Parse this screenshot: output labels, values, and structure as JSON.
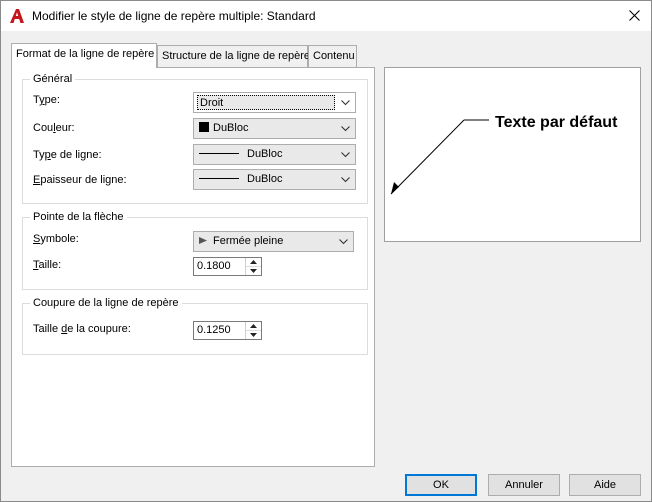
{
  "window": {
    "title": "Modifier le style de ligne de repère multiple: Standard",
    "icon": "autocad-a-icon",
    "brand_color": "#c4161c"
  },
  "tabs": [
    {
      "label": "Format de la ligne de repère",
      "active": true
    },
    {
      "label": "Structure de la ligne de repère",
      "active": false
    },
    {
      "label": "Contenu",
      "active": false
    }
  ],
  "general": {
    "legend": "Général",
    "type_label_pre": "T",
    "type_label_u": "y",
    "type_label_post": "pe:",
    "type_value": "Droit",
    "color_label_pre": "Cou",
    "color_label_u": "l",
    "color_label_post": "eur:",
    "color_value": "DuBloc",
    "linetype_label_pre": "Ty",
    "linetype_label_u": "p",
    "linetype_label_post": "e de ligne:",
    "linetype_value": "DuBloc",
    "lineweight_label_pre": "",
    "lineweight_label_u": "E",
    "lineweight_label_post": "paisseur de ligne:",
    "lineweight_value": "DuBloc"
  },
  "arrowhead": {
    "legend": "Pointe de la flèche",
    "symbol_label_pre": "",
    "symbol_label_u": "S",
    "symbol_label_post": "ymbole:",
    "symbol_value": "Fermée pleine",
    "size_label_pre": "",
    "size_label_u": "T",
    "size_label_post": "aille:",
    "size_value": "0.1800"
  },
  "landing": {
    "legend": "Coupure de la ligne de repère",
    "break_label_pre": "Taille ",
    "break_label_u": "d",
    "break_label_post": "e la coupure:",
    "break_value": "0.1250"
  },
  "preview": {
    "text": "Texte par défaut"
  },
  "buttons": {
    "ok": "OK",
    "cancel": "Annuler",
    "help": "Aide"
  }
}
